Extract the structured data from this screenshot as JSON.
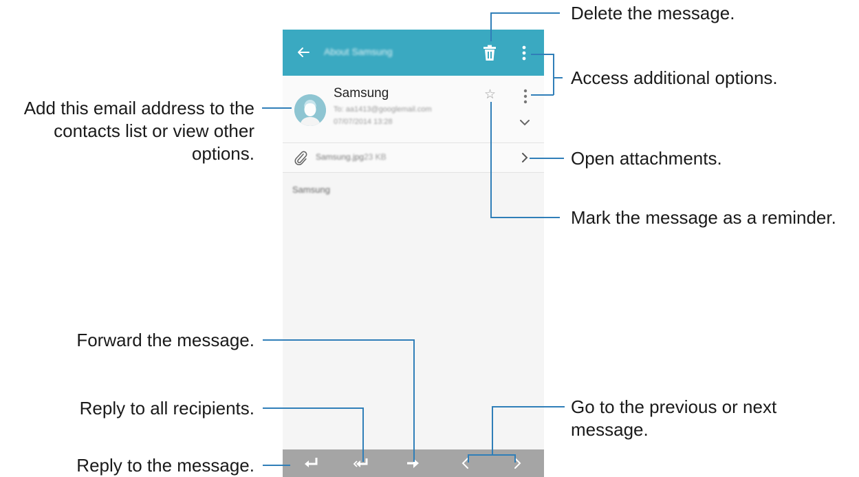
{
  "app_bar": {
    "title": "About Samsung",
    "icons": {
      "back": "back-arrow-icon",
      "delete": "trash-icon",
      "more": "more-vert-icon"
    }
  },
  "message": {
    "sender": "Samsung",
    "to": "To: aa1413@googlemail.com",
    "date": "07/07/2014 13:28",
    "attachment_name": "Samsung.jpg",
    "attachment_size": "23 KB",
    "body_text": "Samsung"
  },
  "colors": {
    "accent": "#3aa9c1",
    "callout_line": "#2f7eb8",
    "bottom_bar": "#a5a5a5"
  },
  "callouts": {
    "delete": "Delete the message.",
    "more_options": "Access additional options.",
    "add_contact": [
      "Add this email address to the",
      "contacts list or view other",
      "options."
    ],
    "attachments": "Open attachments.",
    "reminder": "Mark the message as a reminder.",
    "forward": "Forward the message.",
    "reply_all": "Reply to all recipients.",
    "prev_next": [
      "Go to the previous or next",
      "message."
    ],
    "reply": "Reply to the message."
  }
}
